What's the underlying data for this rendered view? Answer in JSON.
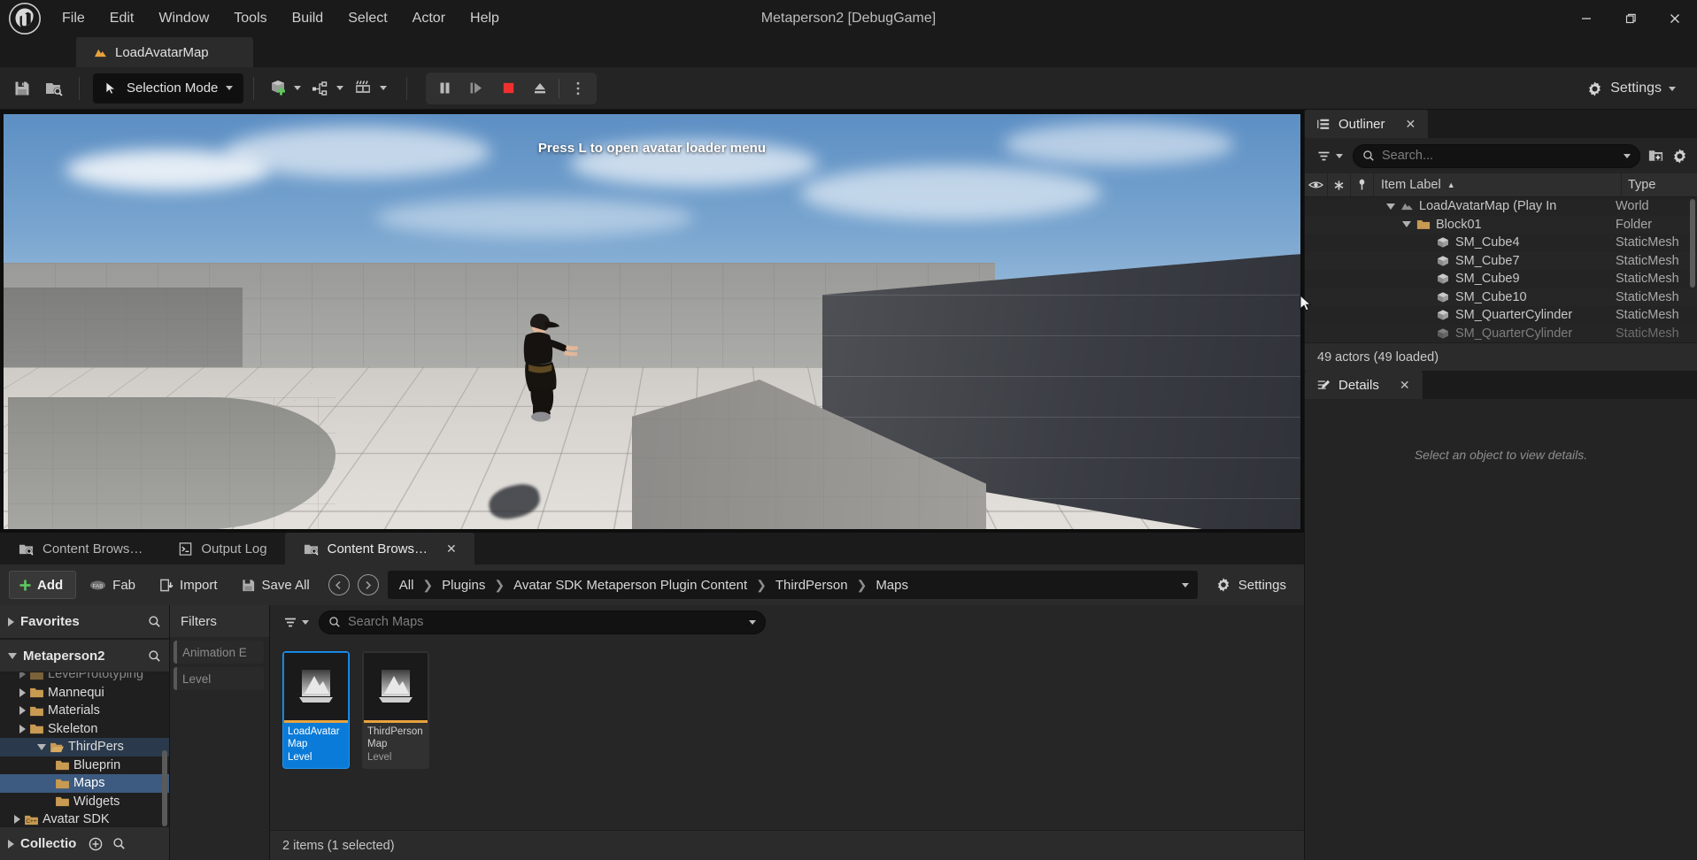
{
  "window": {
    "title": "Metaperson2 [DebugGame]",
    "minimize": "—",
    "maximize": "❐",
    "close": "✕"
  },
  "menubar": {
    "items": [
      "File",
      "Edit",
      "Window",
      "Tools",
      "Build",
      "Select",
      "Actor",
      "Help"
    ]
  },
  "level_tab": {
    "label": "LoadAvatarMap"
  },
  "toolbar": {
    "save_tooltip": "Save",
    "browse_tooltip": "Browse",
    "mode_label": "Selection Mode",
    "create_tooltip": "Add",
    "blueprints_tooltip": "Blueprints",
    "cinematics_tooltip": "Cinematics",
    "pause_tooltip": "Pause",
    "frame_tooltip": "Frame Advance",
    "stop_tooltip": "Stop",
    "eject_tooltip": "Eject",
    "more_tooltip": "More",
    "settings_label": "Settings"
  },
  "viewport": {
    "overlay_text": "Press L to open avatar loader menu"
  },
  "outliner": {
    "tab_label": "Outliner",
    "close": "✕",
    "search_placeholder": "Search...",
    "columns": {
      "visibility": "",
      "pinned": "",
      "lock": "",
      "item_label": "Item Label",
      "type": "Type"
    },
    "sort_arrow": "▲",
    "rows": [
      {
        "label": "LoadAvatarMap (Play In",
        "type": "World",
        "indent": 92,
        "icon": "map-icon",
        "expander": "down"
      },
      {
        "label": "Block01",
        "type": "Folder",
        "indent": 110,
        "icon": "folder-icon",
        "expander": "down"
      },
      {
        "label": "SM_Cube4",
        "type": "StaticMesh",
        "indent": 148,
        "icon": "staticmesh-icon",
        "expander": "none"
      },
      {
        "label": "SM_Cube7",
        "type": "StaticMesh",
        "indent": 148,
        "icon": "staticmesh-icon",
        "expander": "none"
      },
      {
        "label": "SM_Cube9",
        "type": "StaticMesh",
        "indent": 148,
        "icon": "staticmesh-icon",
        "expander": "none"
      },
      {
        "label": "SM_Cube10",
        "type": "StaticMesh",
        "indent": 148,
        "icon": "staticmesh-icon",
        "expander": "none"
      },
      {
        "label": "SM_QuarterCylinder",
        "type": "StaticMesh",
        "indent": 148,
        "icon": "staticmesh-icon",
        "expander": "none"
      },
      {
        "label": "SM_QuarterCylinder",
        "type": "StaticMesh",
        "indent": 148,
        "icon": "staticmesh-icon",
        "expander": "none"
      }
    ],
    "status": "49 actors (49 loaded)"
  },
  "details": {
    "tab_label": "Details",
    "close": "✕",
    "empty_text": "Select an object to view details."
  },
  "content_browser": {
    "tabs": [
      {
        "label": "Content Brows…",
        "active": false,
        "closable": false
      },
      {
        "label": "Output Log",
        "active": false,
        "closable": false
      },
      {
        "label": "Content Brows…",
        "active": true,
        "closable": true
      }
    ],
    "toolbar": {
      "add_label": "Add",
      "fab_label": "Fab",
      "import_label": "Import",
      "save_all_label": "Save All",
      "back_tooltip": "Back",
      "forward_tooltip": "Forward",
      "settings_label": "Settings"
    },
    "breadcrumb": [
      "All",
      "Plugins",
      "Avatar SDK Metaperson Plugin Content",
      "ThirdPerson",
      "Maps"
    ],
    "breadcrumb_sep": "❯",
    "sidebar": {
      "favorites_label": "Favorites",
      "project_label": "Metaperson2",
      "collections_label": "Collectio",
      "tree": [
        {
          "label": "LevelPrototyping",
          "indent": 22,
          "expander": "right",
          "state": "clipped"
        },
        {
          "label": "Mannequi",
          "indent": 22,
          "expander": "right",
          "state": "normal"
        },
        {
          "label": "Materials",
          "indent": 22,
          "expander": "right",
          "state": "normal"
        },
        {
          "label": "Skeleton",
          "indent": 22,
          "expander": "right",
          "state": "normal"
        },
        {
          "label": "ThirdPers",
          "indent": 22,
          "expander": "down",
          "state": "highlight"
        },
        {
          "label": "Blueprin",
          "indent": 42,
          "expander": "none",
          "state": "normal"
        },
        {
          "label": "Maps",
          "indent": 42,
          "expander": "none",
          "state": "selected"
        },
        {
          "label": "Widgets",
          "indent": 42,
          "expander": "none",
          "state": "normal"
        },
        {
          "label": "Avatar SDK",
          "indent": 12,
          "expander": "right",
          "state": "cpp"
        }
      ]
    },
    "filters": {
      "title": "Filters",
      "chips": [
        "Animation E",
        "Level"
      ]
    },
    "assets": {
      "search_placeholder": "Search Maps",
      "items": [
        {
          "name": "LoadAvatar Map",
          "type": "Level",
          "selected": true
        },
        {
          "name": "ThirdPerson Map",
          "type": "Level",
          "selected": false
        }
      ],
      "status": "2 items (1 selected)"
    }
  },
  "colors": {
    "accent_blue": "#0a7bd8",
    "asset_accent": "#e8a33d",
    "stop_red": "#f03030",
    "folder": "#c89a52",
    "panel_bg": "#242424"
  }
}
